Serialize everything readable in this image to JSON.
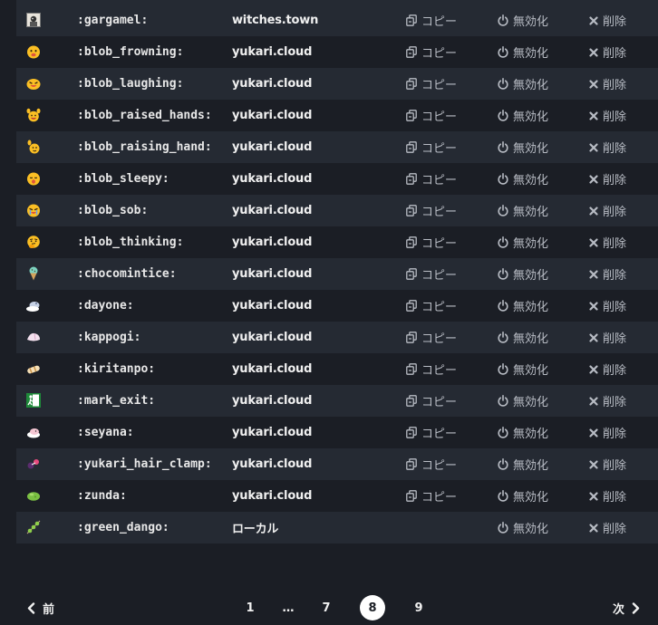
{
  "actions": {
    "copy": "コピー",
    "disable": "無効化",
    "delete": "削除"
  },
  "emojis": [
    {
      "name": ":gargamel:",
      "host": "witches.town",
      "icon": "gargamel-icon"
    },
    {
      "name": ":blob_frowning:",
      "host": "yukari.cloud",
      "icon": "blob-frowning-icon"
    },
    {
      "name": ":blob_laughing:",
      "host": "yukari.cloud",
      "icon": "blob-laughing-icon"
    },
    {
      "name": ":blob_raised_hands:",
      "host": "yukari.cloud",
      "icon": "blob-raised-hands-icon"
    },
    {
      "name": ":blob_raising_hand:",
      "host": "yukari.cloud",
      "icon": "blob-raising-hand-icon"
    },
    {
      "name": ":blob_sleepy:",
      "host": "yukari.cloud",
      "icon": "blob-sleepy-icon"
    },
    {
      "name": ":blob_sob:",
      "host": "yukari.cloud",
      "icon": "blob-sob-icon"
    },
    {
      "name": ":blob_thinking:",
      "host": "yukari.cloud",
      "icon": "blob-thinking-icon"
    },
    {
      "name": ":chocomintice:",
      "host": "yukari.cloud",
      "icon": "chocomintice-icon"
    },
    {
      "name": ":dayone:",
      "host": "yukari.cloud",
      "icon": "dayone-icon"
    },
    {
      "name": ":kappogi:",
      "host": "yukari.cloud",
      "icon": "kappogi-icon"
    },
    {
      "name": ":kiritanpo:",
      "host": "yukari.cloud",
      "icon": "kiritanpo-icon"
    },
    {
      "name": ":mark_exit:",
      "host": "yukari.cloud",
      "icon": "mark-exit-icon"
    },
    {
      "name": ":seyana:",
      "host": "yukari.cloud",
      "icon": "seyana-icon"
    },
    {
      "name": ":yukari_hair_clamp:",
      "host": "yukari.cloud",
      "icon": "yukari-hair-clamp-icon"
    },
    {
      "name": ":zunda:",
      "host": "yukari.cloud",
      "icon": "zunda-icon"
    },
    {
      "name": ":green_dango:",
      "host": "ローカル",
      "icon": "green-dango-icon",
      "local": true
    }
  ],
  "pagination": {
    "prev": "前",
    "next": "次",
    "pages": [
      "1",
      "…",
      "7",
      "8",
      "9"
    ],
    "current": "8"
  }
}
